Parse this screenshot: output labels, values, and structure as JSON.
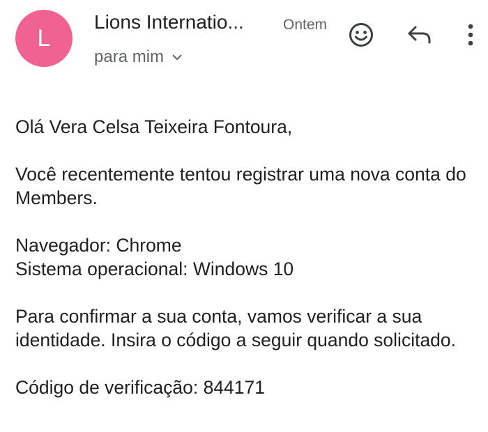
{
  "header": {
    "avatar_letter": "L",
    "avatar_color": "#f06292",
    "sender": "Lions Internatio...",
    "date": "Ontem",
    "recipient": "para mim",
    "icons": {
      "emoji": "add-reaction-icon",
      "reply": "reply-icon",
      "more": "more-vert-icon",
      "expand": "chevron-down-icon"
    }
  },
  "message": {
    "greeting": "Olá Vera Celsa Teixeira Fontoura,",
    "intro": "Você recentemente tentou registrar uma nova conta do Members.",
    "browser": "Navegador: Chrome",
    "os": "Sistema operacional: Windows 10",
    "instruction": "Para confirmar a sua conta, vamos verificar a sua identidade. Insira o código a seguir quando solicitado.",
    "code_line": "Código de verificação: 844171"
  }
}
